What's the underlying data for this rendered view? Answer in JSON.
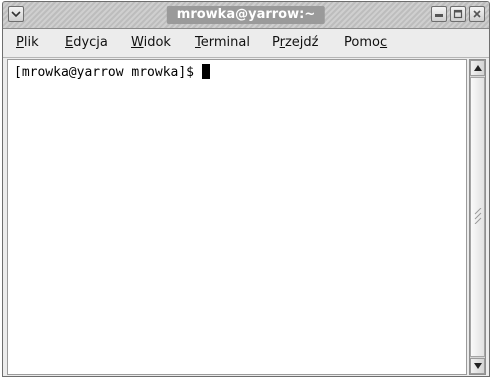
{
  "window": {
    "title": "mrowka@yarrow:~"
  },
  "menubar": {
    "items": [
      {
        "pre": "",
        "mnemonic": "P",
        "post": "lik"
      },
      {
        "pre": "",
        "mnemonic": "E",
        "post": "dycja"
      },
      {
        "pre": "",
        "mnemonic": "W",
        "post": "idok"
      },
      {
        "pre": "",
        "mnemonic": "T",
        "post": "erminal"
      },
      {
        "pre": "P",
        "mnemonic": "r",
        "post": "zejdź"
      },
      {
        "pre": "Pomo",
        "mnemonic": "c",
        "post": ""
      }
    ]
  },
  "terminal": {
    "prompt": "[mrowka@yarrow mrowka]$"
  },
  "icons": {
    "window_menu": "chevron-down-icon",
    "minimize": "minimize-icon",
    "maximize": "maximize-icon",
    "close": "close-icon",
    "scroll_up": "arrow-up-icon",
    "scroll_down": "arrow-down-icon"
  }
}
